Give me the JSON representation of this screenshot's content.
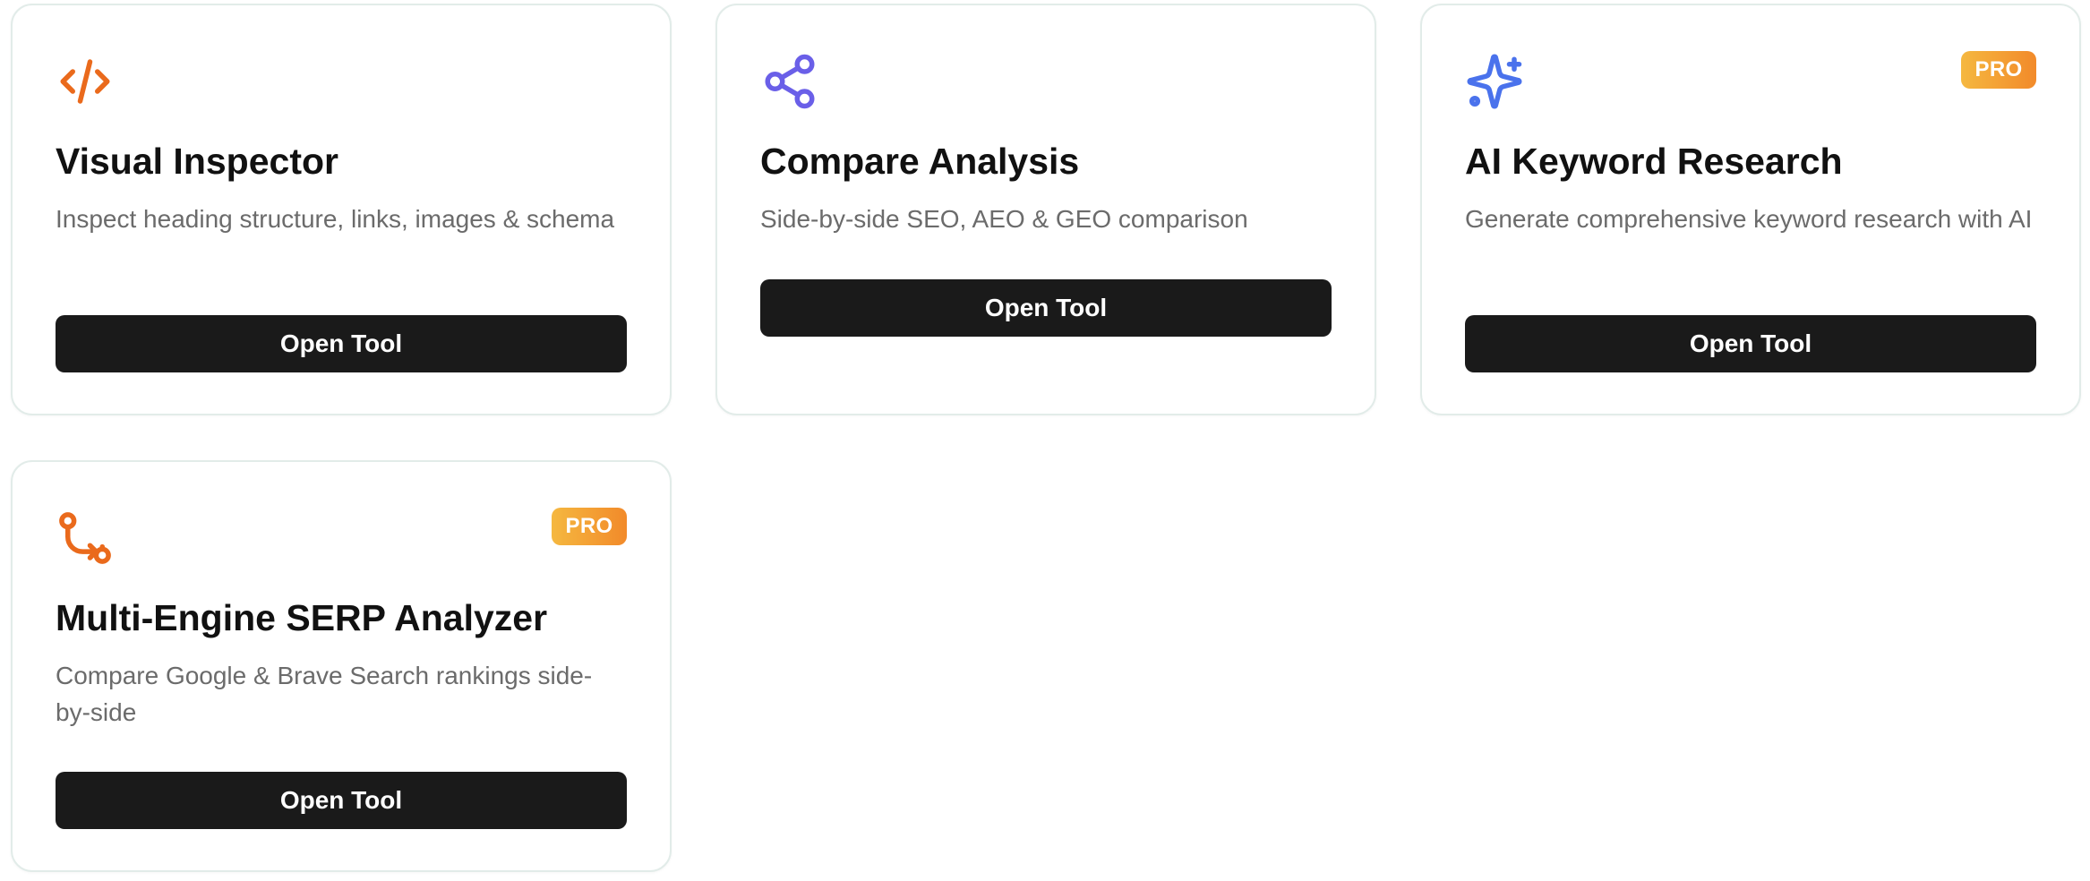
{
  "cards": [
    {
      "icon": "code-icon",
      "title": "Visual Inspector",
      "description": "Inspect heading structure, links, images & schema",
      "button_label": "Open Tool",
      "badge": null
    },
    {
      "icon": "share-icon",
      "title": "Compare Analysis",
      "description": "Side-by-side SEO, AEO & GEO comparison",
      "button_label": "Open Tool",
      "badge": null
    },
    {
      "icon": "sparkles-icon",
      "title": "AI Keyword Research",
      "description": "Generate comprehensive keyword research with AI",
      "button_label": "Open Tool",
      "badge": "PRO"
    },
    {
      "icon": "git-compare-icon",
      "title": "Multi-Engine SERP Analyzer",
      "description": "Compare Google & Brave Search rankings side-by-side",
      "button_label": "Open Tool",
      "badge": "PRO"
    }
  ],
  "colors": {
    "orange_icon": "#ea6a1c",
    "purple_icon": "#6a5fe8",
    "blue_icon": "#4a72ec",
    "button_bg": "#1a1a1a",
    "badge_start": "#f5b840",
    "badge_end": "#f28a2a"
  }
}
